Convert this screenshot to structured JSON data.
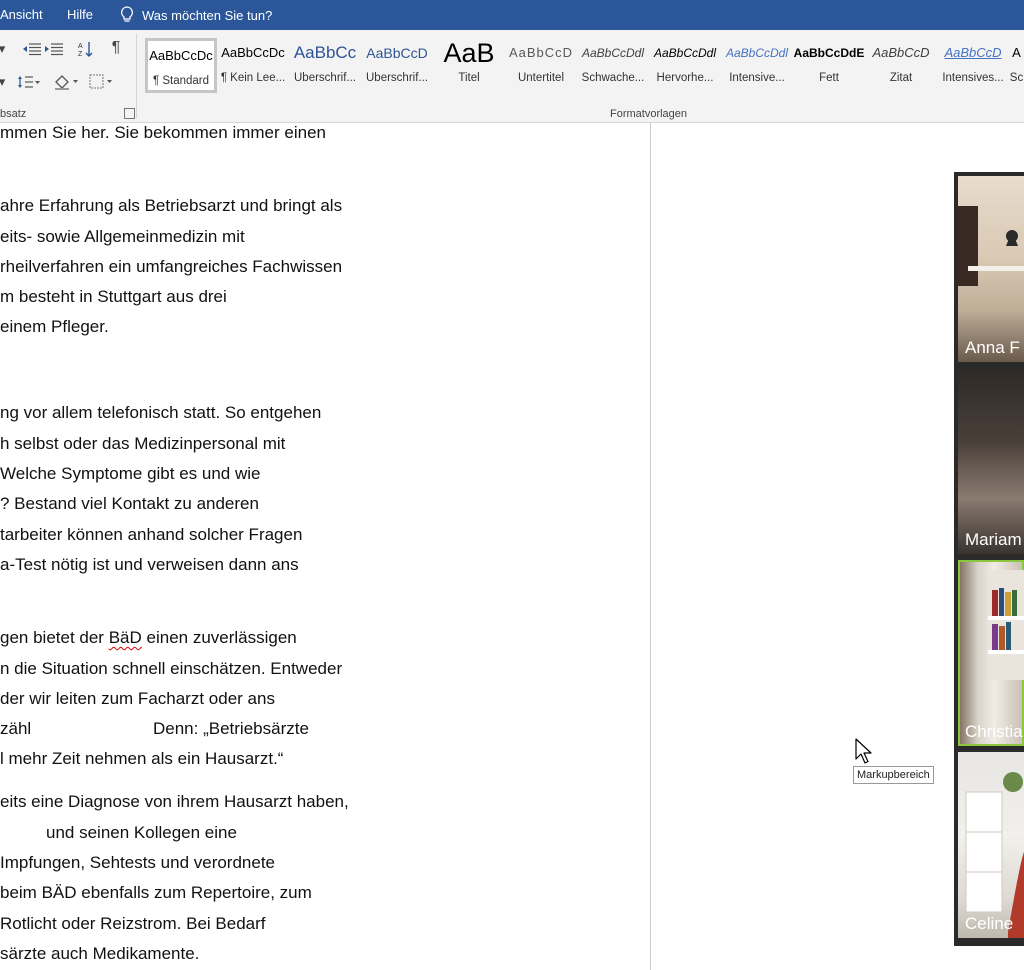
{
  "ribbon_tabs": {
    "tab_ansicht": "Ansicht",
    "tab_hilfe": "Hilfe",
    "tell_me": "Was möchten Sie tun?"
  },
  "paragraph_group": {
    "label": "bsatz",
    "pilcrow": "¶"
  },
  "styles_group": {
    "label": "Formatvorlagen",
    "items": [
      {
        "preview": "AaBbCcDc",
        "name": "¶ Standard",
        "selected": true
      },
      {
        "preview": "AaBbCcDc",
        "name": "¶ Kein Lee..."
      },
      {
        "preview": "AaBbCc",
        "name": "Überschrif..."
      },
      {
        "preview": "AaBbCcD",
        "name": "Überschrif..."
      },
      {
        "preview": "AaB",
        "name": "Titel"
      },
      {
        "preview": "AaBbCcD",
        "name": "Untertitel"
      },
      {
        "preview": "AaBbCcDdl",
        "name": "Schwache..."
      },
      {
        "preview": "AaBbCcDdl",
        "name": "Hervorhe..."
      },
      {
        "preview": "AaBbCcDdl",
        "name": "Intensive..."
      },
      {
        "preview": "AaBbCcDdE",
        "name": "Fett"
      },
      {
        "preview": "AaBbCcD",
        "name": "Zitat"
      },
      {
        "preview": "AaBbCcD",
        "name": "Intensives..."
      },
      {
        "preview": "A",
        "name": "Sc"
      }
    ]
  },
  "document": {
    "lines": [
      "mmen Sie her. Sie bekommen immer einen",
      "ahre Erfahrung als Betriebsarzt und bringt als",
      "eits- sowie Allgemeinmedizin mit",
      "rheilverfahren ein umfangreiches Fachwissen",
      "m besteht in Stuttgart aus drei",
      " einem Pfleger.",
      "ng vor allem telefonisch statt. So entgehen",
      "h selbst oder das Medizinpersonal mit",
      " Welche Symptome gibt es und wie",
      "? Bestand viel Kontakt zu anderen",
      "tarbeiter können anhand solcher Fragen",
      "a-Test nötig ist und verweisen dann ans",
      "gen bietet der ",
      "BäD",
      " einen zuverlässigen",
      "n die Situation schnell einschätzen. Entweder",
      "der wir leiten zum Facharzt oder ans",
      "zähl",
      "Denn: „Betriebsärzte",
      "l mehr Zeit nehmen als ein Hausarzt.“",
      "eits eine Diagnose von ihrem Hausarzt haben,",
      "und seinen Kollegen eine",
      " Impfungen, Sehtests und verordnete",
      "beim BÄD ebenfalls zum Repertoire, zum",
      "Rotlicht oder Reizstrom. Bei Bedarf",
      "särzte auch Medikamente."
    ]
  },
  "tooltip": {
    "text": "Markupbereich"
  },
  "video_call": {
    "participants": [
      {
        "name": "Anna F"
      },
      {
        "name": "Mariam"
      },
      {
        "name": "Christia",
        "active": true
      },
      {
        "name": "Celine"
      }
    ]
  }
}
